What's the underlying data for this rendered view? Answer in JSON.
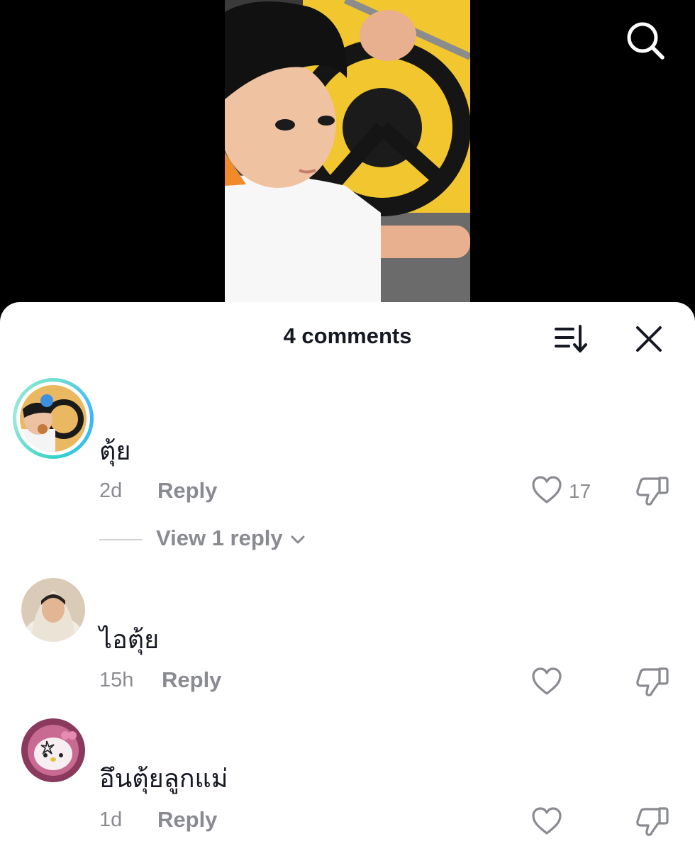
{
  "header": {
    "count_label": "4 comments"
  },
  "comments": [
    {
      "text": "ตุ้ย",
      "time": "2d",
      "reply_label": "Reply",
      "likes": "17",
      "view_replies_label": "View 1 reply"
    },
    {
      "text": "ไอตุ้ย",
      "time": "15h",
      "reply_label": "Reply",
      "likes": ""
    },
    {
      "text": "อึนตุ้ยลูกแม่",
      "time": "1d",
      "reply_label": "Reply",
      "likes": ""
    }
  ],
  "colors": {
    "text_primary": "#161823",
    "text_secondary": "#8a8b91",
    "ring_accent": "#3ab4ff"
  },
  "icons": [
    "search-icon",
    "sort-icon",
    "close-icon",
    "heart-icon",
    "dislike-icon",
    "chevron-down-icon"
  ]
}
